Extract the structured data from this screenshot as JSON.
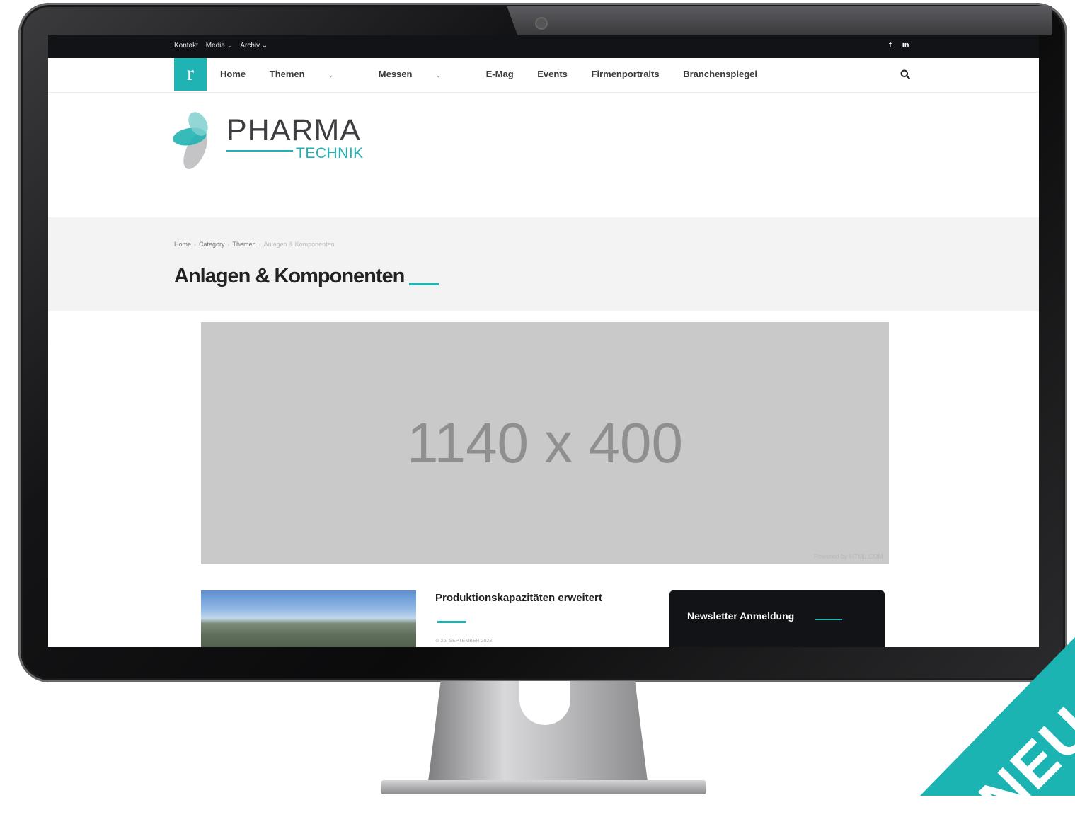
{
  "topbar": {
    "links": [
      "Kontakt",
      "Media ⌄",
      "Archiv ⌄"
    ],
    "social": [
      "f",
      "in"
    ]
  },
  "nav": {
    "logo_letter": "r",
    "items": [
      "Home",
      "Themen",
      "Messen",
      "E-Mag",
      "Events",
      "Firmenportraits",
      "Branchenspiegel"
    ],
    "caret": "⌄",
    "search_icon": "search-icon"
  },
  "brand": {
    "title": "PHARMA",
    "subtitle": "TECHNIK"
  },
  "breadcrumb": [
    "Home",
    "Category",
    "Themen",
    "Anlagen & Komponenten"
  ],
  "breadcrumb_sep": "›",
  "page": {
    "title": "Anlagen & Komponenten"
  },
  "banner": {
    "text": "1140 x 400",
    "credit": "Powered by HTML.COM"
  },
  "post": {
    "title": "Produktionskapazitäten erweitert",
    "date": "⊙ 25. SEPTEMBER 2023"
  },
  "sidebar": {
    "newsletter_title": "Newsletter Anmeldung"
  },
  "badge": {
    "text": "NEU"
  },
  "colors": {
    "accent": "#20b3b3",
    "dark": "#121316"
  }
}
